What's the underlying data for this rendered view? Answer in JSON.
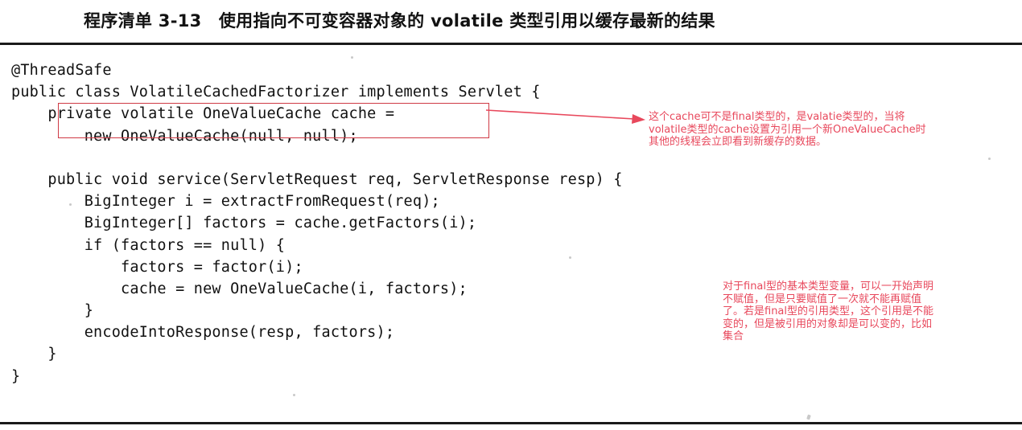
{
  "title": "程序清单 3-13　使用指向不可变容器对象的 volatile 类型引用以缓存最新的结果",
  "colors": {
    "annotation_red": "#e8485c",
    "box_red": "#cf3a45",
    "rule_black": "#1a1a1a",
    "code_black": "#111111"
  },
  "code": {
    "language": "java",
    "lines": [
      "@ThreadSafe",
      "public class VolatileCachedFactorizer implements Servlet {",
      "    private volatile OneValueCache cache =",
      "        new OneValueCache(null, null);",
      "",
      "    public void service(ServletRequest req, ServletResponse resp) {",
      "        BigInteger i = extractFromRequest(req);",
      "        BigInteger[] factors = cache.getFactors(i);",
      "        if (factors == null) {",
      "            factors = factor(i);",
      "            cache = new OneValueCache(i, factors);",
      "        }",
      "        encodeIntoResponse(resp, factors);",
      "    }",
      "}"
    ]
  },
  "annotations": {
    "volatile_note": "这个cache可不是final类型的，是valatie类型的，当将\nvolatile类型的cache设置为引用一个新OneValueCache时\n其他的线程会立即看到新缓存的数据。",
    "final_note": "对于final型的基本类型变量，可以一开始声明\n不赋值，但是只要赋值了一次就不能再赋值\n了。若是final型的引用类型，这个引用是不能\n变的，但是被引用的对象却是可以变的，比如\n集合"
  },
  "highlight": {
    "target_line": "    private volatile OneValueCache cache ="
  }
}
